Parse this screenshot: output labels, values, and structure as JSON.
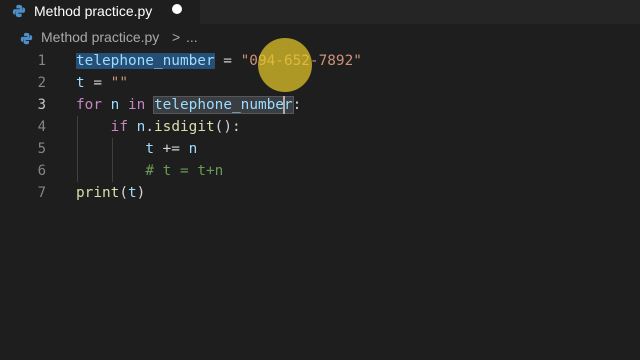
{
  "tab": {
    "icon": "python-file-icon",
    "label": "Method practice.py",
    "dirty": true
  },
  "breadcrumb": {
    "icon": "python-file-icon",
    "file": "Method practice.py",
    "separator": ">",
    "more": "..."
  },
  "editor": {
    "active_line": 3,
    "lines": [
      {
        "number": "1",
        "tokens": [
          {
            "t": "telephone_number",
            "c": "var hl-sel"
          },
          {
            "t": " = ",
            "c": "op"
          },
          {
            "t": "\"094-652-7892\"",
            "c": "str"
          }
        ]
      },
      {
        "number": "2",
        "tokens": [
          {
            "t": "t",
            "c": "var"
          },
          {
            "t": " = ",
            "c": "op"
          },
          {
            "t": "\"\"",
            "c": "str"
          }
        ]
      },
      {
        "number": "3",
        "tokens": [
          {
            "t": "for",
            "c": "kw"
          },
          {
            "t": " ",
            "c": "op"
          },
          {
            "t": "n",
            "c": "var"
          },
          {
            "t": " ",
            "c": "op"
          },
          {
            "t": "in",
            "c": "kw"
          },
          {
            "t": " ",
            "c": "op"
          },
          {
            "t": "telephone_number",
            "c": "var hl-occ"
          },
          {
            "t": ":",
            "c": "op"
          }
        ]
      },
      {
        "number": "4",
        "tokens": [
          {
            "t": "    ",
            "c": "op"
          },
          {
            "t": "if",
            "c": "kw"
          },
          {
            "t": " ",
            "c": "op"
          },
          {
            "t": "n",
            "c": "var"
          },
          {
            "t": ".",
            "c": "op"
          },
          {
            "t": "isdigit",
            "c": "fn"
          },
          {
            "t": "():",
            "c": "op"
          }
        ]
      },
      {
        "number": "5",
        "tokens": [
          {
            "t": "        ",
            "c": "op"
          },
          {
            "t": "t",
            "c": "var"
          },
          {
            "t": " += ",
            "c": "op"
          },
          {
            "t": "n",
            "c": "var"
          }
        ]
      },
      {
        "number": "6",
        "tokens": [
          {
            "t": "        ",
            "c": "op"
          },
          {
            "t": "# t = t+n",
            "c": "comment"
          }
        ]
      },
      {
        "number": "7",
        "tokens": [
          {
            "t": "print",
            "c": "fn"
          },
          {
            "t": "(",
            "c": "op"
          },
          {
            "t": "t",
            "c": "var"
          },
          {
            "t": ")",
            "c": "op"
          }
        ]
      }
    ]
  },
  "colors": {
    "editor_bg": "#1e1e1e",
    "selection": "#264f78",
    "keyword": "#c586c0",
    "variable": "#9cdcfe",
    "string": "#ce9178",
    "function": "#dcdcaa",
    "comment": "#6a9955",
    "mouse_highlight": "#e6c828"
  }
}
